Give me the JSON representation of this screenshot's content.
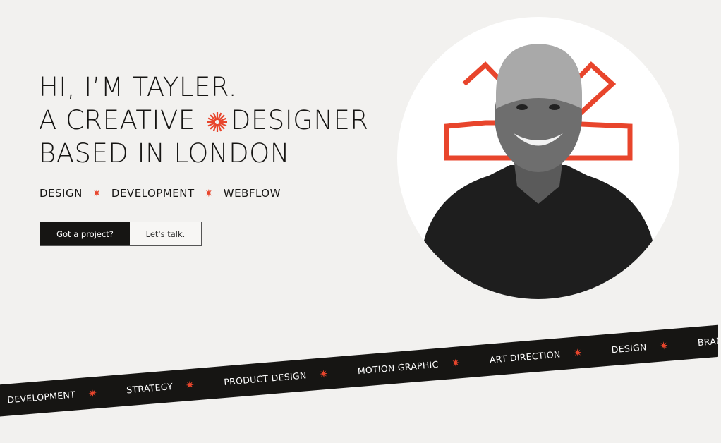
{
  "hero": {
    "line1": "HI, I’M TAYLER.",
    "line2a": "A CREATIVE",
    "line2b": "DESIGNER",
    "line3": "BASED IN LONDON"
  },
  "services": [
    "DESIGN",
    "DEVELOPMENT",
    "WEBFLOW"
  ],
  "cta": {
    "primary": "Got a project?",
    "secondary": "Let's talk."
  },
  "ticker": [
    "DEVELOPMENT",
    "STRATEGY",
    "PRODUCT DESIGN",
    "MOTION GRAPHIC",
    "ART DIRECTION",
    "DESIGN",
    "BRANDING"
  ],
  "colors": {
    "accent": "#e8452c",
    "dark": "#161513",
    "background": "#f2f1ef"
  },
  "icons": {
    "separator": "asterisk-star-icon",
    "headline": "sunburst-icon"
  }
}
